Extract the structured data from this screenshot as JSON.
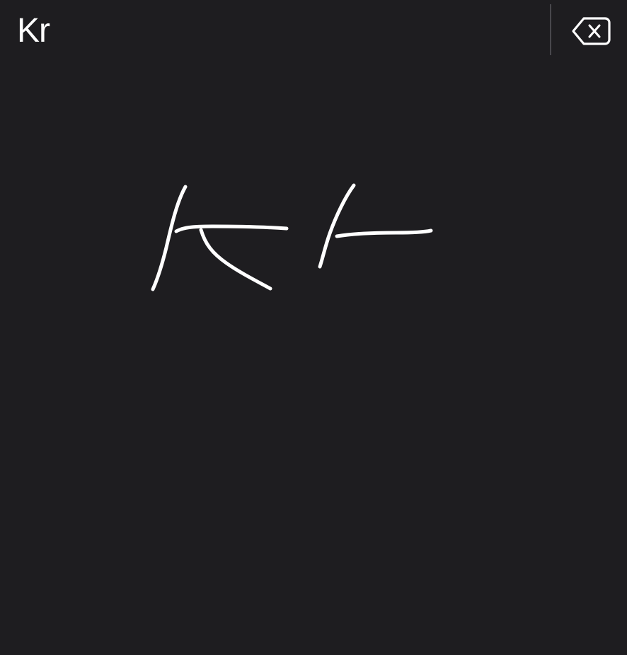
{
  "candidate_bar": {
    "candidates": [
      "Kr"
    ]
  },
  "toolbar": {
    "delete_icon": "delete-left-icon"
  },
  "writing_area": {
    "stroke_count": 6
  },
  "colors": {
    "background": "#1e1d20",
    "ink": "#ffffff",
    "divider": "#48474c"
  }
}
